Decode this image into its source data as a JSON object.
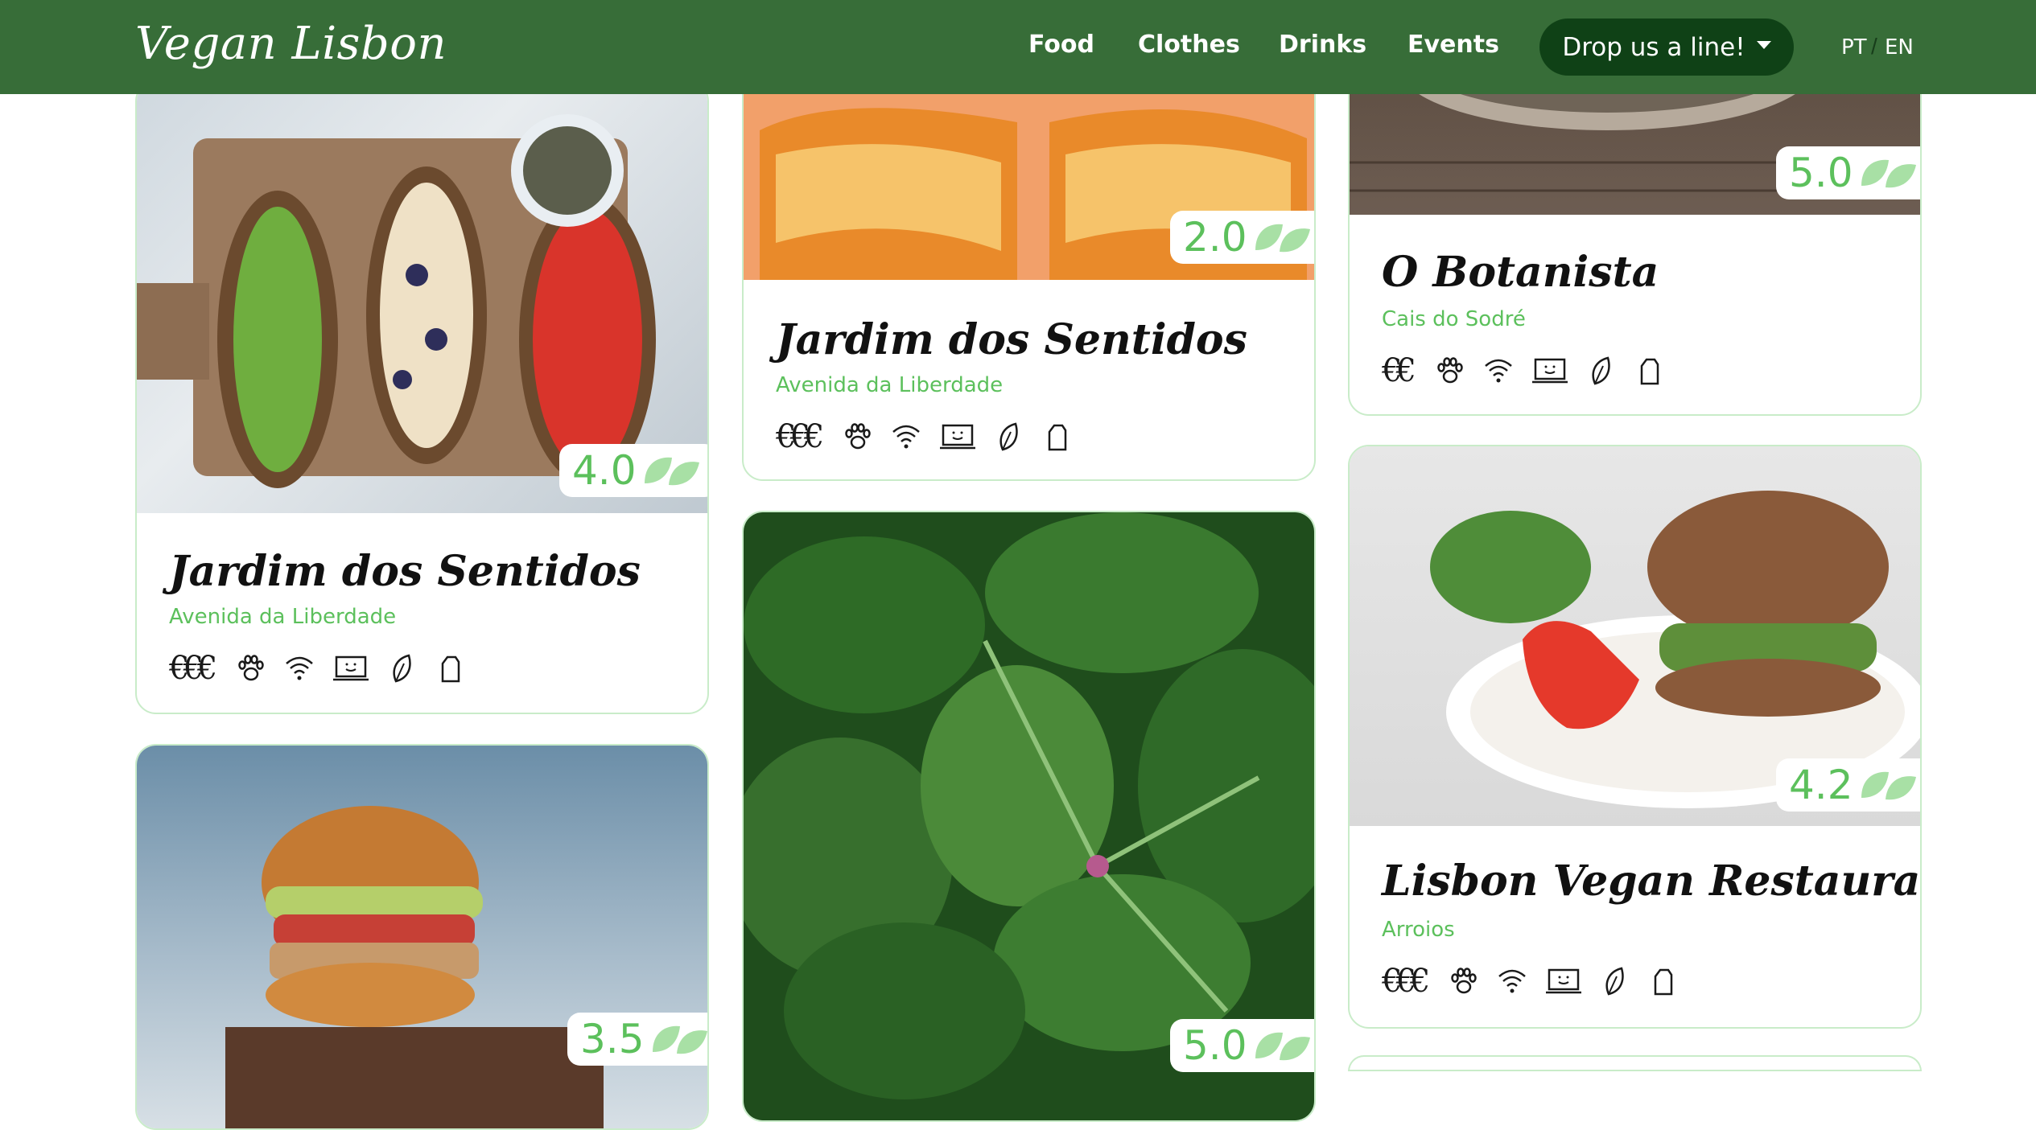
{
  "nav": {
    "brand": "Vegan Lisbon",
    "links": [
      "Food",
      "Clothes",
      "Drinks",
      "Events"
    ],
    "cta": "Drop us a line!",
    "lang_pt": "PT",
    "lang_sep": "/",
    "lang_en": "EN"
  },
  "cards": [
    {
      "title": "Jardim dos Sentidos",
      "location": "Avenida da Liberdade",
      "rating": "4.0",
      "price": "€€€"
    },
    {
      "title": "",
      "location": "",
      "rating": "3.5",
      "price": ""
    },
    {
      "title": "Jardim dos Sentidos",
      "location": "Avenida da Liberdade",
      "rating": "2.0",
      "price": "€€€"
    },
    {
      "title": "",
      "location": "",
      "rating": "5.0",
      "price": ""
    },
    {
      "title": "O Botanista",
      "location": "Cais do Sodré",
      "rating": "5.0",
      "price": "€€"
    },
    {
      "title": "Lisbon Vegan Restaurante",
      "location": "Arroios",
      "rating": "4.2",
      "price": "€€€"
    }
  ],
  "amenity_icons": [
    "paw-icon",
    "wifi-icon",
    "laptop-icon",
    "leaf-icon",
    "bag-icon"
  ],
  "colors": {
    "navbar": "#376d38",
    "button": "#0f4116",
    "accent": "#5cc05c",
    "card_border": "#c9ecc9"
  }
}
